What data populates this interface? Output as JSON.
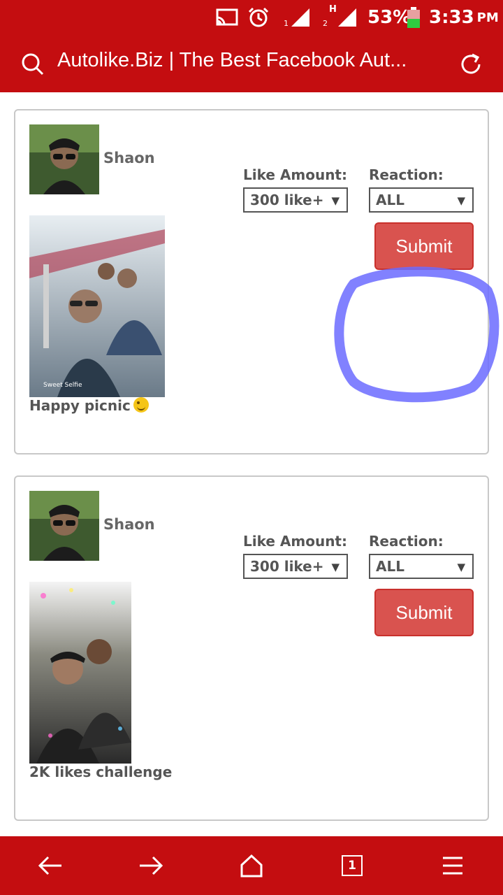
{
  "status_bar": {
    "battery_percent": "53%",
    "time": "3:33",
    "time_suffix": "PM",
    "sim1_label": "1",
    "sim2_label": "2",
    "network_type": "H"
  },
  "address_bar": {
    "title": "Autolike.Biz | The Best Facebook Aut..."
  },
  "posts": [
    {
      "author": "Shaon",
      "caption": "Happy picnic",
      "like_amount_label": "Like Amount:",
      "like_amount_value": "300 like+",
      "reaction_label": "Reaction:",
      "reaction_value": "ALL",
      "submit_label": "Submit"
    },
    {
      "author": "Shaon",
      "caption": "2K likes challenge",
      "like_amount_label": "Like Amount:",
      "like_amount_value": "300 like+",
      "reaction_label": "Reaction:",
      "reaction_value": "ALL",
      "submit_label": "Submit"
    }
  ],
  "bottom_nav": {
    "tab_count": "1"
  },
  "colors": {
    "brand_red": "#c40d10",
    "submit_red": "#d9534f",
    "annotation_blue": "#6b6bff"
  }
}
